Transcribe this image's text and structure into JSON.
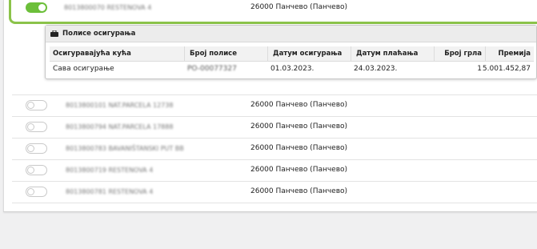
{
  "selected_row": {
    "toggle_on": true,
    "id_blurred": "8013800070 RESTENOVA 4",
    "address": "26000 Панчево (Панчево)"
  },
  "policies": {
    "title": "Полисе осигурања",
    "columns": [
      "Осигуравајућа кућа",
      "Број полисе",
      "Датум осигурања",
      "Датум плаћања",
      "Број грла",
      "Премија"
    ],
    "rows": [
      {
        "insurer": "Сава осигурање",
        "policy_no": "PO-00077327",
        "insured_date": "01.03.2023.",
        "payment_date": "24.03.2023.",
        "head_count": "1",
        "premium": "5.001.452,87"
      }
    ]
  },
  "rows": [
    {
      "toggle_on": false,
      "id_blurred": "8013800101 NAT.PARCELA 12738",
      "address": "26000 Панчево (Панчево)"
    },
    {
      "toggle_on": false,
      "id_blurred": "8013800794 NAT.PARCELA 17888",
      "address": "26000 Панчево (Панчево)"
    },
    {
      "toggle_on": false,
      "id_blurred": "8013800783 BAVANIŠTANSKI PUT BB",
      "address": "26000 Панчево (Панчево)"
    },
    {
      "toggle_on": false,
      "id_blurred": "8013800719 RESTENOVA 4",
      "address": "26000 Панчево (Панчево)"
    },
    {
      "toggle_on": false,
      "id_blurred": "8013800781 RESTENOVA 4",
      "address": "26000 Панчево (Панчево)"
    }
  ],
  "colors": {
    "accent_green": "#8bc34a",
    "toggle_on": "#6cbf3a"
  }
}
